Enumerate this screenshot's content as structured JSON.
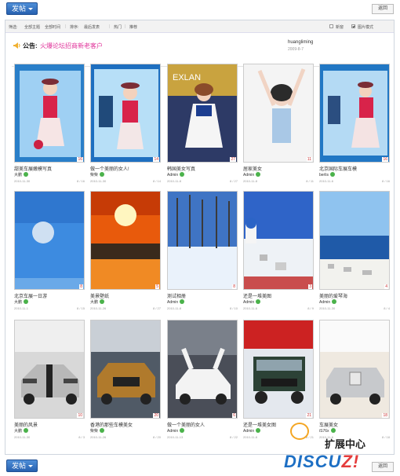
{
  "toolbar": {
    "post_label": "发帖",
    "back_label": "返回"
  },
  "filters": {
    "items": [
      "筛选:",
      "全部主题",
      "全部时间",
      "排序:",
      "最后发表",
      "热门",
      "推荐"
    ],
    "checkbox_1": "新窗",
    "checkbox_2": "图片模式"
  },
  "notice": {
    "label": "公告:",
    "text": "火爆论坛招商新老客户",
    "user": "huangliming",
    "date": "2009-8-7"
  },
  "colors": {
    "accent": "#2761b0",
    "notice_text": "#e0339a",
    "logo_blue": "#1d6fc4",
    "logo_red": "#e43c3c"
  },
  "items": [
    {
      "title": "甜美车展嫩模写真",
      "author": "大鹏",
      "date": "2010-11-30",
      "count": "8 / 16",
      "num": "16",
      "img": "model-pink-booth"
    },
    {
      "title": "做一个美丽的女人!",
      "author": "柴柴",
      "date": "2010-11-30",
      "count": "8 / 14",
      "num": "14",
      "img": "model-hat-phone"
    },
    {
      "title": "韩国美女写真",
      "author": "Admin",
      "date": "2010-11-8",
      "count": "8 / 27",
      "num": "27",
      "img": "model-white-dress"
    },
    {
      "title": "居家美女",
      "author": "Admin",
      "date": "2010-11-8",
      "count": "8 / 11",
      "num": "11",
      "img": "girl-stretch"
    },
    {
      "title": "北京国际车展车模",
      "author": "berlis",
      "date": "2010-11-6",
      "count": "8 / 16",
      "num": "16",
      "img": "model-red-booth"
    },
    {
      "title": "北京车展一日游",
      "author": "大鹏",
      "date": "2010-11-1",
      "count": "8 / 15",
      "num": "8",
      "img": "moon-sky"
    },
    {
      "title": "美景壁纸",
      "author": "大鹏",
      "date": "2010-11-26",
      "count": "8 / 27",
      "num": "5",
      "img": "sunset"
    },
    {
      "title": "测试相册",
      "author": "Admin",
      "date": "2010-11-8",
      "count": "8 / 10",
      "num": "8",
      "img": "snow-trees"
    },
    {
      "title": "还是一堆美图",
      "author": "Admin",
      "date": "2010-11-6",
      "count": "8 / 9",
      "num": "3",
      "img": "santorini"
    },
    {
      "title": "美丽的爱琴海",
      "author": "Admin",
      "date": "2010-11-30",
      "count": "8 / 4",
      "num": "4",
      "img": "aegean"
    },
    {
      "title": "美丽的风景",
      "author": "大鹏",
      "date": "2010-11-30",
      "count": "8 / 3",
      "num": "10",
      "img": "lambo"
    },
    {
      "title": "香港的那些车模美女",
      "author": "柴柴",
      "date": "2010-11-26",
      "count": "8 / 20",
      "num": "20",
      "img": "audi"
    },
    {
      "title": "做一个美丽的女人",
      "author": "Admin",
      "date": "2010-11-13",
      "count": "8 / 22",
      "num": "6",
      "img": "white-supercar"
    },
    {
      "title": "还是一堆美女图",
      "author": "Admin",
      "date": "2010-11-8",
      "count": "8 / 21",
      "num": "21",
      "img": "jeep"
    },
    {
      "title": "车展美女",
      "author": "iS76x",
      "date": "2010-11-6",
      "count": "8 / 18",
      "num": "18",
      "img": "rolls"
    }
  ],
  "logo": {
    "cn": "扩展中心",
    "en_1": "DISCU",
    "en_2": "Z!"
  }
}
